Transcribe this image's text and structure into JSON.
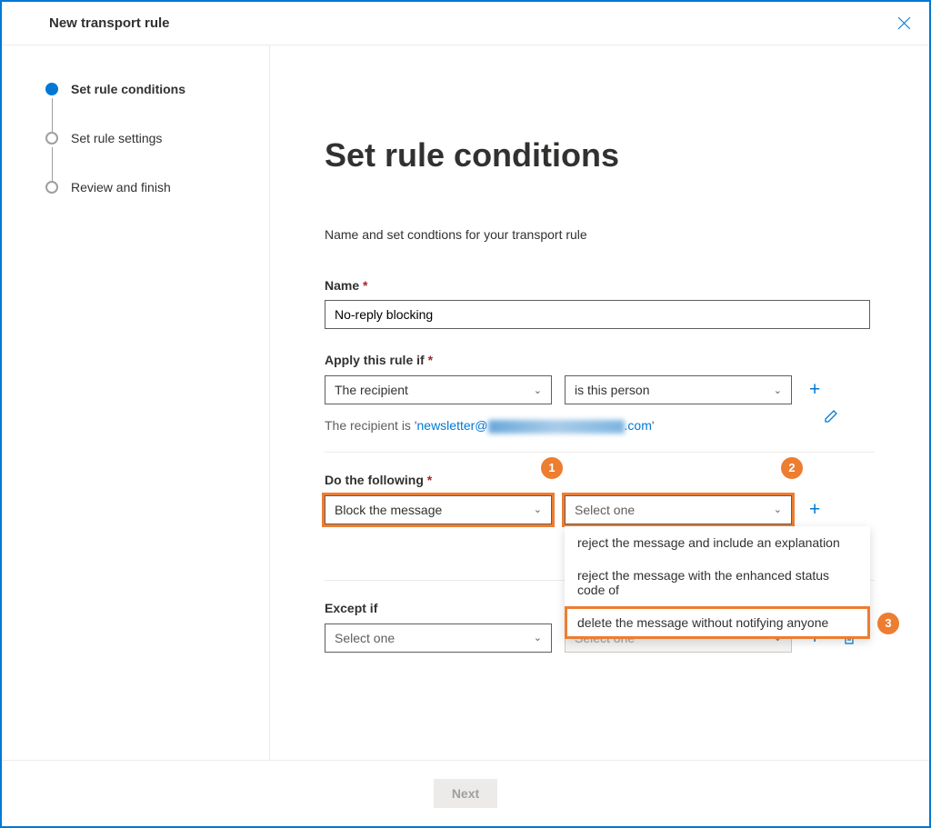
{
  "header": {
    "title": "New transport rule"
  },
  "sidebar": {
    "steps": [
      {
        "label": "Set rule conditions",
        "active": true
      },
      {
        "label": "Set rule settings",
        "active": false
      },
      {
        "label": "Review and finish",
        "active": false
      }
    ]
  },
  "main": {
    "title": "Set rule conditions",
    "subtitle": "Name and set condtions for your transport rule",
    "name_label": "Name",
    "name_value": "No-reply blocking",
    "apply_if_label": "Apply this rule if",
    "apply_if_select1": "The recipient",
    "apply_if_select2": "is this person",
    "recipient_prefix": "The recipient is '",
    "recipient_email_prefix": "newsletter@",
    "recipient_email_suffix": ".com",
    "recipient_suffix": "'",
    "do_following_label": "Do the following",
    "do_following_select1": "Block the message",
    "do_following_select2": "Select one",
    "dropdown_options": [
      "reject the message and include an explanation",
      "reject the message with the enhanced status code of",
      "delete the message without notifying anyone"
    ],
    "except_if_label": "Except if",
    "except_if_select1": "Select one",
    "except_if_select2": "Select one"
  },
  "callouts": {
    "c1": "1",
    "c2": "2",
    "c3": "3"
  },
  "footer": {
    "next": "Next"
  }
}
